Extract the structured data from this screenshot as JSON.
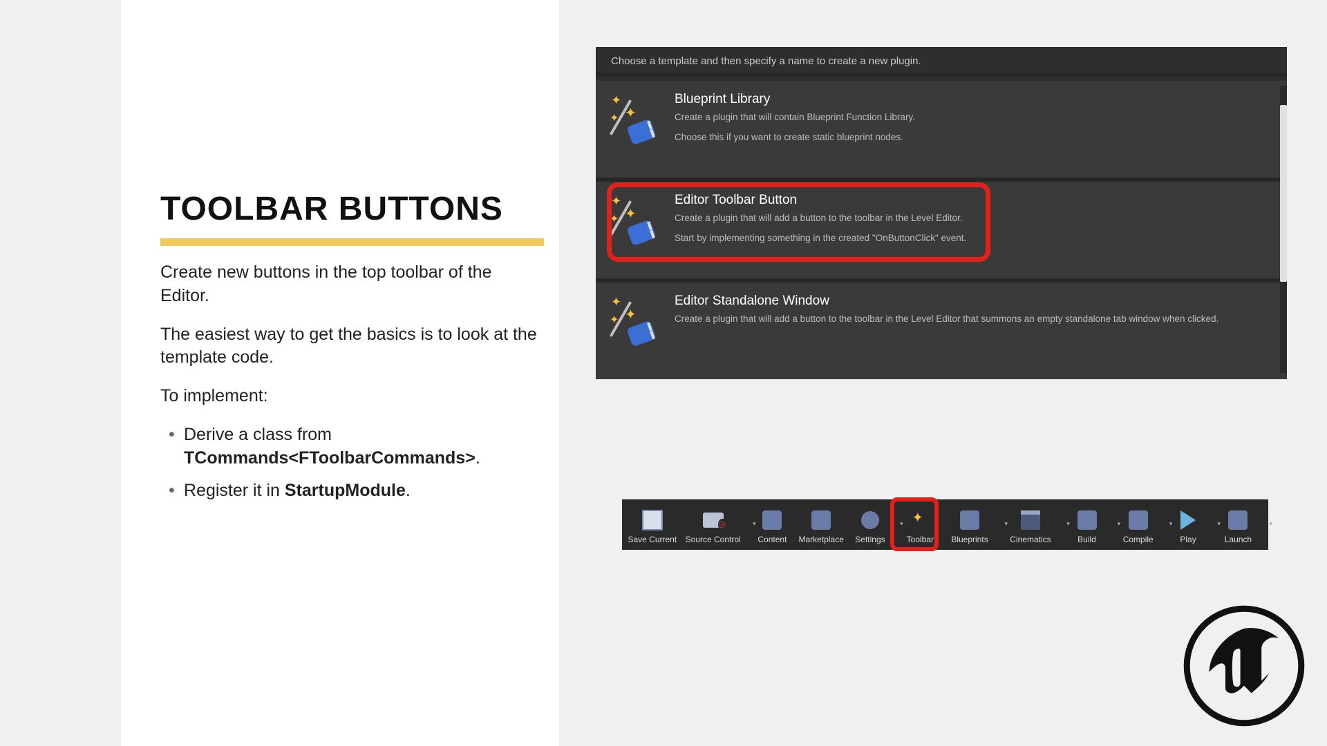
{
  "slide": {
    "title": "TOOLBAR BUTTONS",
    "p1": "Create new buttons in the top toolbar of the Editor.",
    "p2": "The easiest way to get the basics is to look at the template code.",
    "p3": "To implement:",
    "li1a": "Derive a class from ",
    "li1b": "TCommands<FToolbarCommands>",
    "li1c": ".",
    "li2a": "Register it in ",
    "li2b": "StartupModule",
    "li2c": "."
  },
  "plugin": {
    "header": "Choose a template and then specify a name to create a new plugin.",
    "rows": [
      {
        "title": "Blueprint Library",
        "desc1": "Create a plugin that will contain Blueprint Function Library.",
        "desc2": "Choose this if you want to create static blueprint nodes."
      },
      {
        "title": "Editor Toolbar Button",
        "desc1": "Create a plugin that will add a button to the toolbar in the Level Editor.",
        "desc2": "Start by implementing something in the created \"OnButtonClick\" event."
      },
      {
        "title": "Editor Standalone Window",
        "desc1": "Create a plugin that will add a button to the toolbar in the Level Editor that summons an empty standalone tab window when clicked.",
        "desc2": ""
      }
    ]
  },
  "toolbar": {
    "items": [
      {
        "label": "Save Current"
      },
      {
        "label": "Source Control"
      },
      {
        "label": "Content"
      },
      {
        "label": "Marketplace"
      },
      {
        "label": "Settings"
      },
      {
        "label": "Toolbar"
      },
      {
        "label": "Blueprints"
      },
      {
        "label": "Cinematics"
      },
      {
        "label": "Build"
      },
      {
        "label": "Compile"
      },
      {
        "label": "Play"
      },
      {
        "label": "Launch"
      }
    ]
  }
}
